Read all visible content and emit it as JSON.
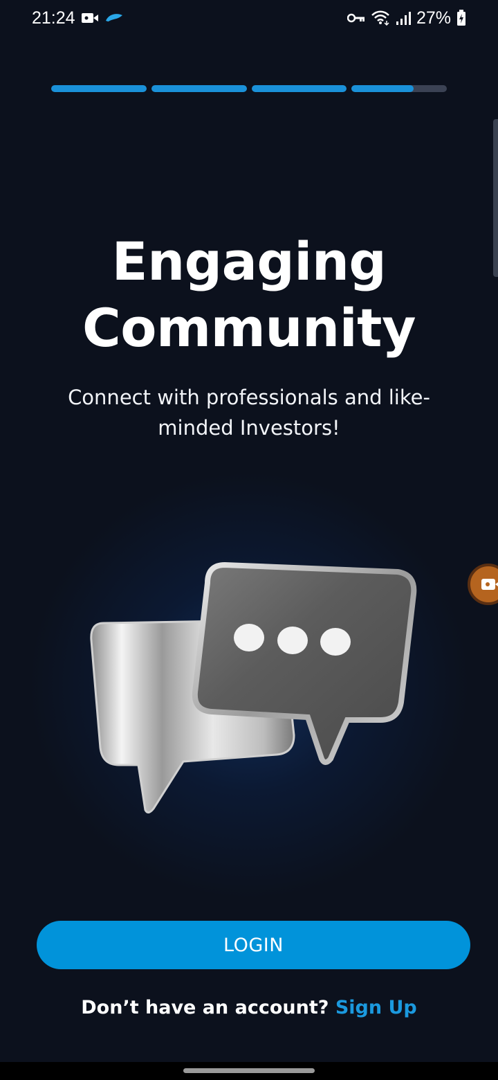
{
  "status_bar": {
    "time": "21:24",
    "battery": "27%",
    "icons": [
      "video-camera-icon",
      "app-notification-icon",
      "key-icon",
      "wifi-icon",
      "signal-icon",
      "battery-charging-icon"
    ]
  },
  "onboarding": {
    "pages_total": 4,
    "progress": [
      1.0,
      1.0,
      1.0,
      0.65
    ],
    "progress_color": "#1a91d9",
    "progress_track_color": "#3b4254"
  },
  "hero": {
    "title_line1": "Engaging",
    "title_line2": "Community",
    "subtitle_line1": "Connect with professionals and like-",
    "subtitle_line2": "minded Investors!",
    "illustration": "chat-bubbles-icon"
  },
  "actions": {
    "login_label": "LOGIN",
    "signup_prompt": "Don’t have an account?",
    "signup_link": "Sign Up",
    "accent_color": "#0193da"
  },
  "overlay": {
    "screen_recorder": "screen-recorder-icon"
  }
}
